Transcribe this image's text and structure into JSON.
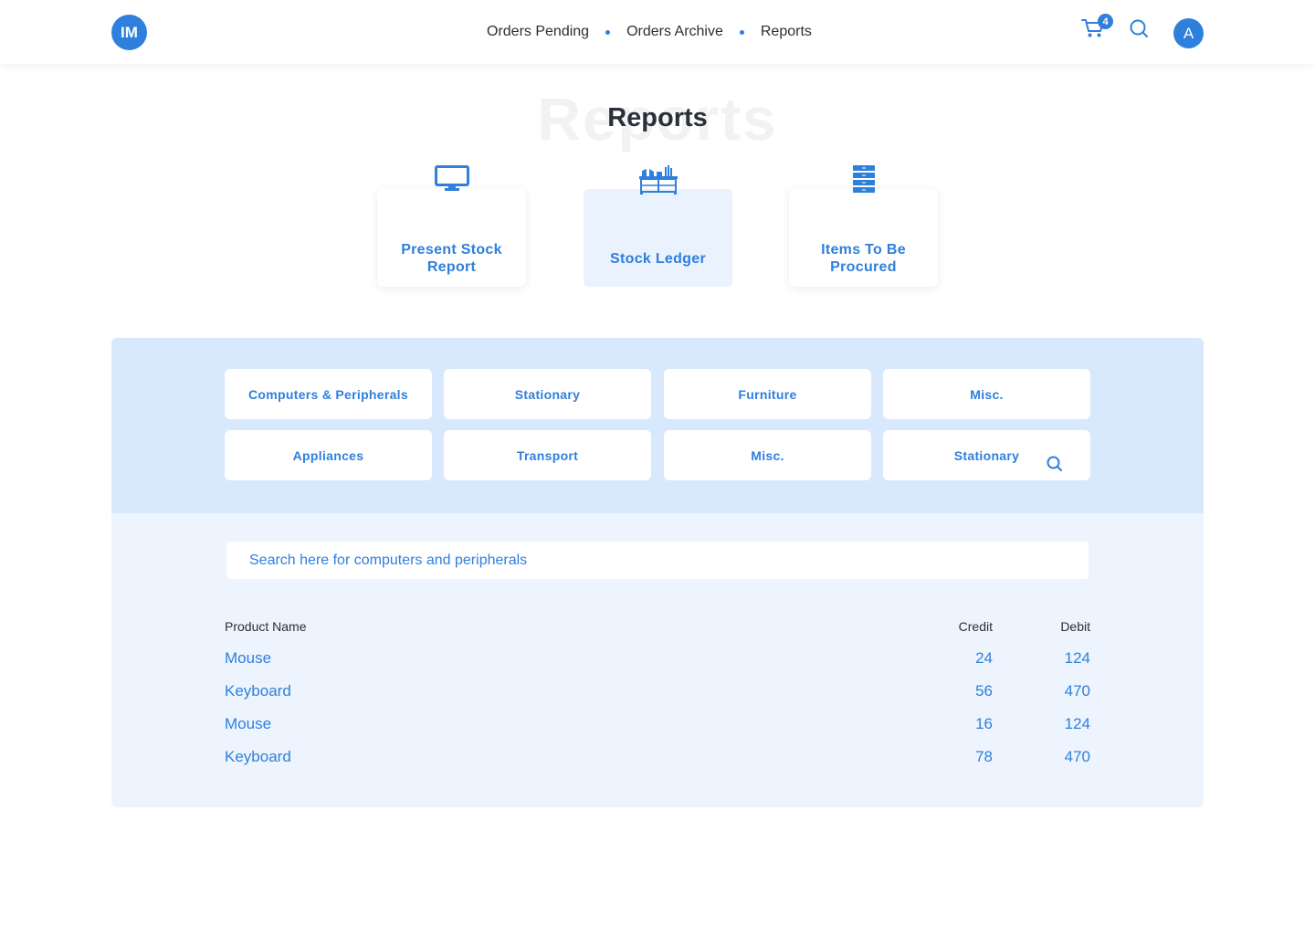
{
  "header": {
    "logo": "IM",
    "nav": [
      "Orders Pending",
      "Orders Archive",
      "Reports"
    ],
    "cart_count": "4",
    "avatar": "A"
  },
  "page": {
    "title": "Reports",
    "title_ghost": "Reports"
  },
  "report_cards": [
    {
      "label": "Present Stock Report",
      "icon": "monitor-icon"
    },
    {
      "label": "Stock Ledger",
      "icon": "shelf-icon"
    },
    {
      "label": "Items To Be Procured",
      "icon": "drawers-icon"
    }
  ],
  "categories": [
    "Computers & Peripherals",
    "Stationary",
    "Furniture",
    "Misc.",
    "Appliances",
    "Transport",
    "Misc.",
    "Stationary"
  ],
  "search": {
    "placeholder": "Search here for computers and peripherals"
  },
  "table": {
    "headers": {
      "product": "Product Name",
      "credit": "Credit",
      "debit": "Debit"
    },
    "rows": [
      {
        "product": "Mouse",
        "credit": "24",
        "debit": "124"
      },
      {
        "product": "Keyboard",
        "credit": "56",
        "debit": "470"
      },
      {
        "product": "Mouse",
        "credit": "16",
        "debit": "124"
      },
      {
        "product": "Keyboard",
        "credit": "78",
        "debit": "470"
      }
    ]
  },
  "colors": {
    "accent": "#2f7fdc",
    "panel_top": "#d8e8fd",
    "panel_bottom": "#edf4fd"
  }
}
